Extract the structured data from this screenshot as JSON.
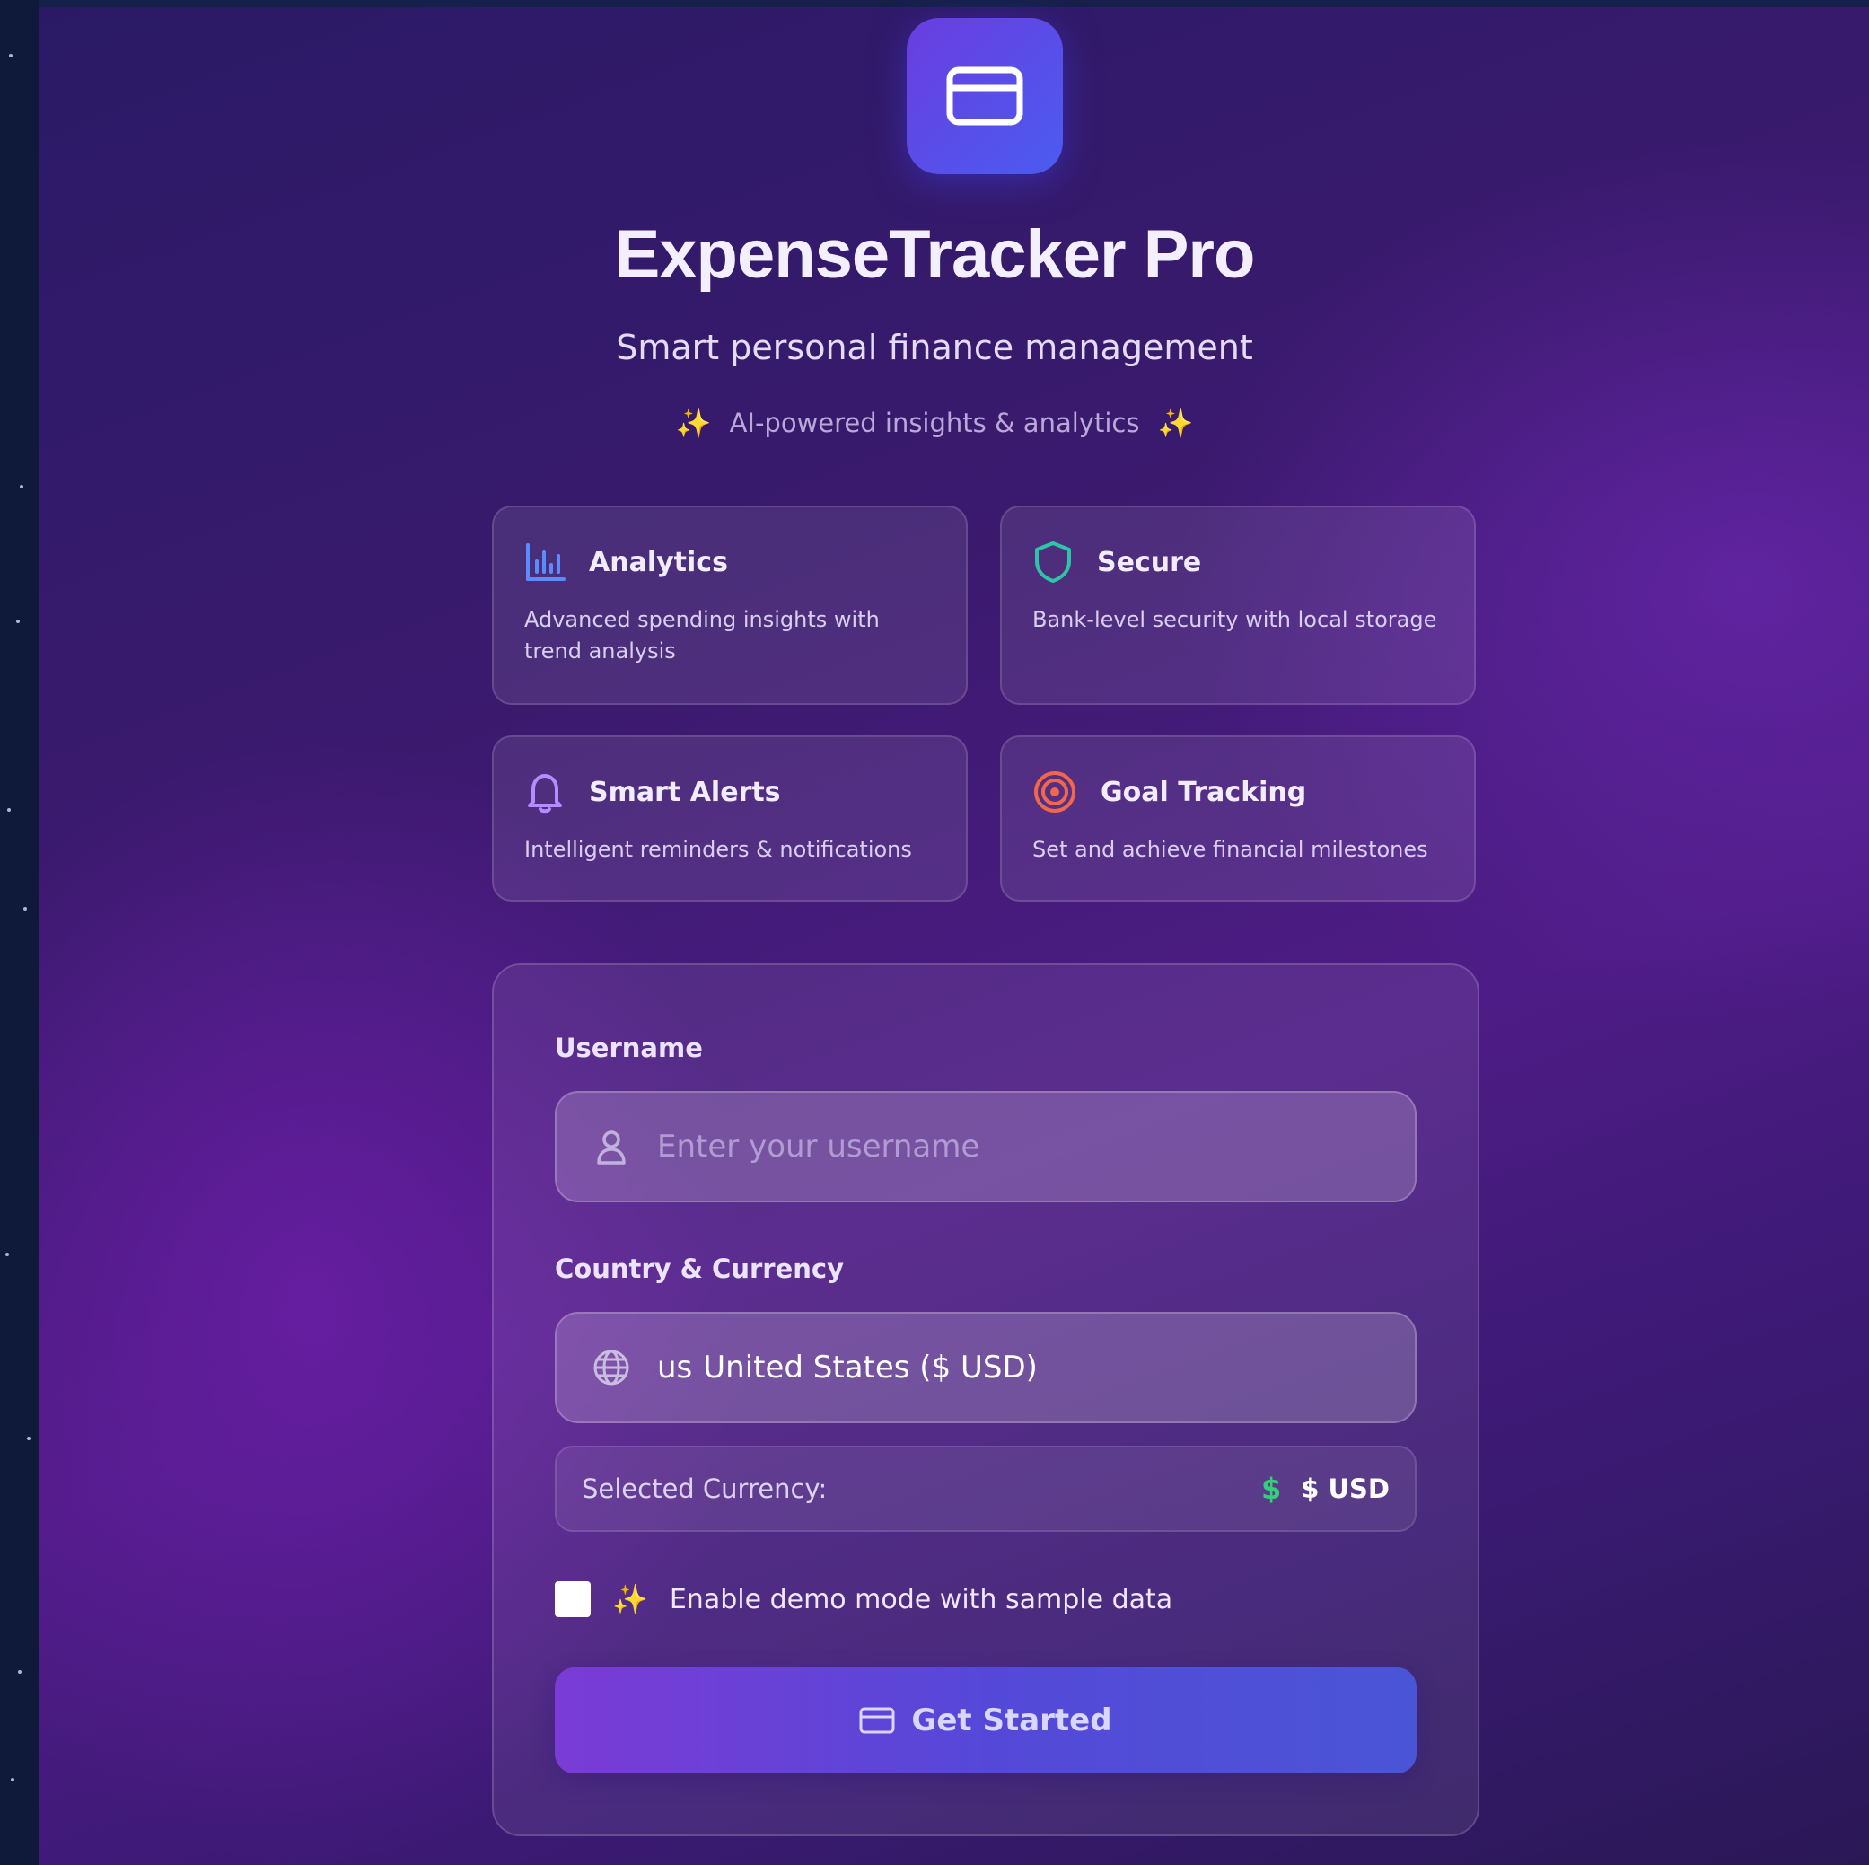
{
  "app": {
    "title": "ExpenseTracker Pro",
    "subtitle": "Smart personal finance management",
    "tagline": "AI-powered insights & analytics",
    "logo_icon": "credit-card-icon"
  },
  "features": [
    {
      "title": "Analytics",
      "description": "Advanced spending insights with trend analysis",
      "icon": "bar-chart-icon",
      "icon_color": "#5b8cff"
    },
    {
      "title": "Secure",
      "description": "Bank-level security with local storage",
      "icon": "shield-icon",
      "icon_color": "#2fc4a8"
    },
    {
      "title": "Smart Alerts",
      "description": "Intelligent reminders & notifications",
      "icon": "bell-icon",
      "icon_color": "#b48cff"
    },
    {
      "title": "Goal Tracking",
      "description": "Set and achieve financial milestones",
      "icon": "target-icon",
      "icon_color": "#f2674a"
    }
  ],
  "form": {
    "username_label": "Username",
    "username_placeholder": "Enter your username",
    "username_value": "",
    "country_label": "Country & Currency",
    "country_flag": "us",
    "country_value": "United States ($ USD)",
    "selected_currency_label": "Selected Currency:",
    "selected_currency_value": "$ USD",
    "demo_checkbox_label": "Enable demo mode with sample data",
    "demo_checked": false,
    "submit_label": "Get Started"
  },
  "colors": {
    "accent": "#5a4be0",
    "sparkle": "#f4b63c",
    "currency_icon": "#33d07a"
  }
}
